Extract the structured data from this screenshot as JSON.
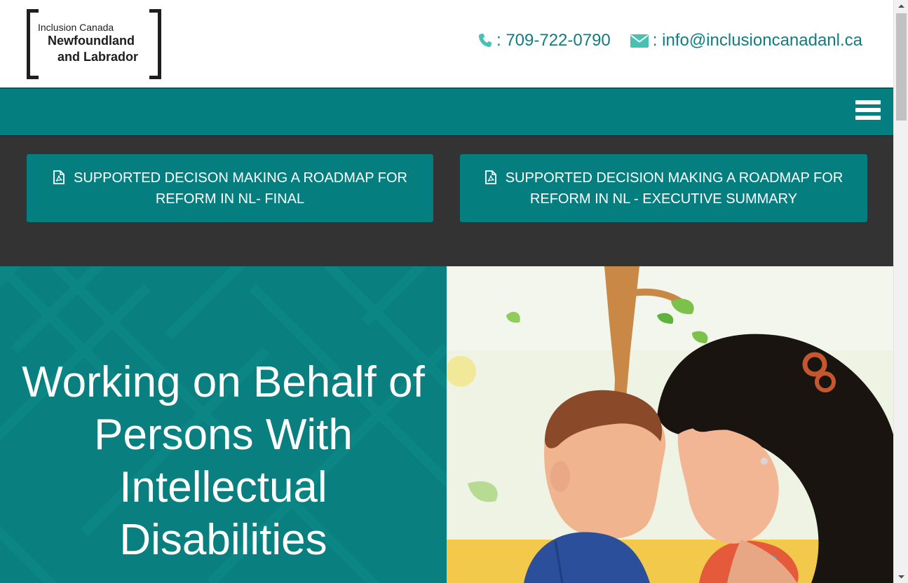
{
  "logo": {
    "line1": "Inclusion Canada",
    "line2": "Newfoundland",
    "line3": "and Labrador"
  },
  "contact": {
    "phone_icon": "phone-icon",
    "phone_label": ": 709-722-0790",
    "email_icon": "envelope-icon",
    "email_label": ": info@inclusioncanadanl.ca"
  },
  "nav": {
    "menu_icon": "hamburger-menu-icon"
  },
  "documents": [
    {
      "icon": "pdf-file-icon",
      "line1": "SUPPORTED DECISON MAKING A ROADMAP FOR",
      "line2": "REFORM IN NL- FINAL"
    },
    {
      "icon": "pdf-file-icon",
      "line1": "SUPPORTED DECISION MAKING A ROADMAP FOR",
      "line2": "REFORM IN NL - EXECUTIVE SUMMARY"
    }
  ],
  "hero": {
    "title_line1": "Working on Behalf of",
    "title_line2": "Persons With",
    "title_line3": "Intellectual",
    "title_line4": "Disabilities"
  },
  "colors": {
    "teal": "#057e80",
    "teal_text": "#0e7e80",
    "icon_teal": "#48c1b2",
    "dark_band": "#333333"
  }
}
